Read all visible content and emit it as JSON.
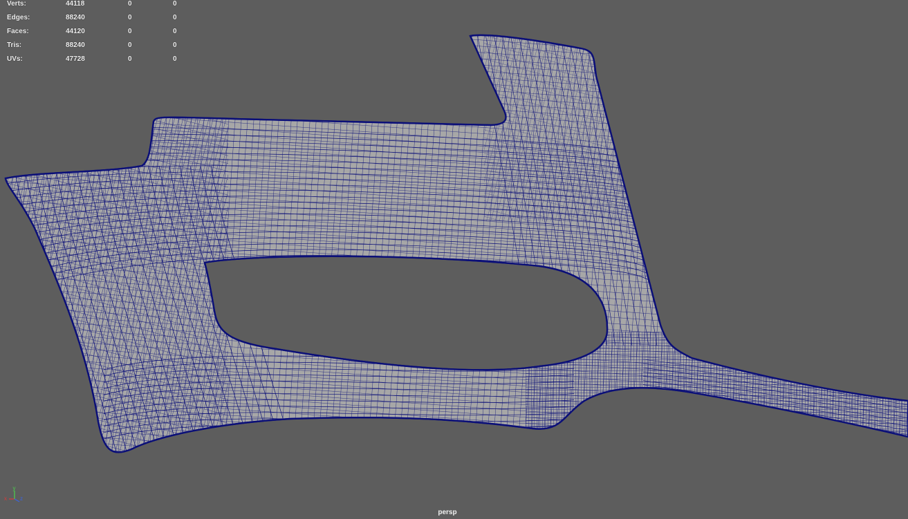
{
  "viewport": {
    "camera_name": "persp",
    "background_color": "#5d5d5d",
    "mesh_fill_color": "#a7a7a7",
    "wire_color": "#0b0f78"
  },
  "heads_up_display": {
    "poly_count": [
      {
        "label": "Verts:",
        "total": "44118",
        "selected": "0",
        "components": "0"
      },
      {
        "label": "Edges:",
        "total": "88240",
        "selected": "0",
        "components": "0"
      },
      {
        "label": "Faces:",
        "total": "44120",
        "selected": "0",
        "components": "0"
      },
      {
        "label": "Tris:",
        "total": "88240",
        "selected": "0",
        "components": "0"
      },
      {
        "label": "UVs:",
        "total": "47728",
        "selected": "0",
        "components": "0"
      }
    ]
  },
  "axis_gizmo": {
    "x_label": "x",
    "y_label": "y",
    "z_label": "z",
    "x_color": "#d83a3a",
    "y_color": "#4cd34c",
    "z_color": "#3a64e0"
  }
}
